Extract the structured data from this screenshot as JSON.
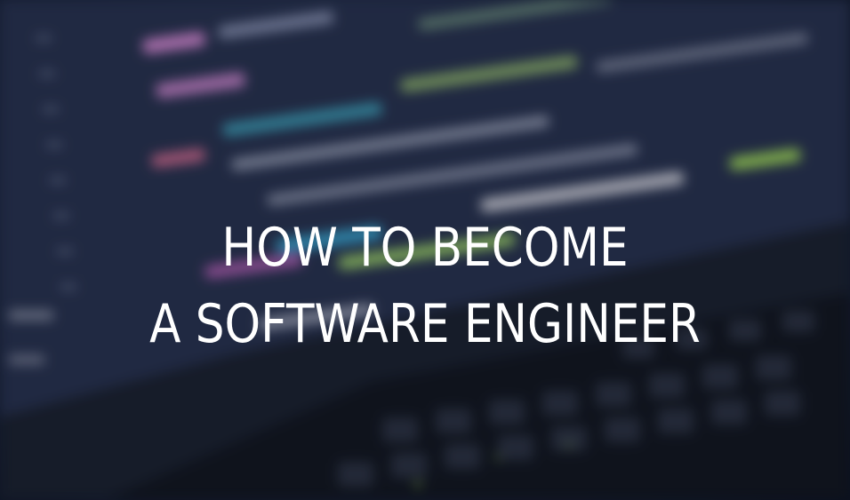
{
  "headline": {
    "line1": "HOW TO BECOME",
    "line2": "A SOFTWARE ENGINEER"
  },
  "background": {
    "description_icon": "blurred-laptop-code-icon",
    "colors": {
      "base": "#1d2740",
      "code_pink": "#d98bd6",
      "code_green": "#9fd46a",
      "code_cyan": "#4fc3d9",
      "code_gray": "#b7bccb",
      "keyboard": "#141820"
    }
  }
}
